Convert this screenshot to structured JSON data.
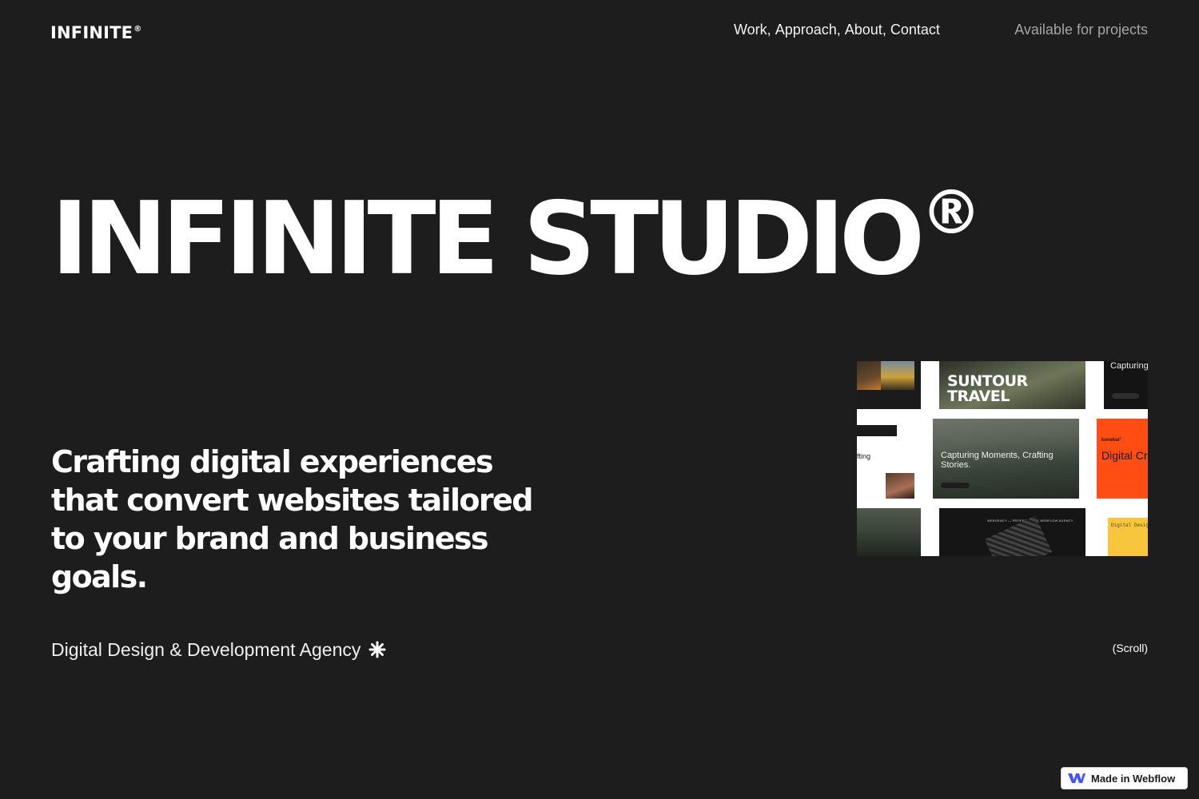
{
  "header": {
    "logo": "INFINITE",
    "logo_mark": "®",
    "nav": [
      {
        "label": "Work",
        "sep": ", "
      },
      {
        "label": "Approach",
        "sep": ", "
      },
      {
        "label": "About",
        "sep": ", "
      },
      {
        "label": "Contact",
        "sep": ""
      }
    ],
    "availability": "Available for projects"
  },
  "hero": {
    "title": "INFINITE STUDIO",
    "title_mark": "®",
    "tagline": "Crafting digital experiences that convert websites tailored to your brand and business goals.",
    "agency": "Digital Design & Development Agency",
    "agency_icon": "asterisk-icon",
    "scroll_hint": "(Scroll)"
  },
  "collage": {
    "suntour": "SUNTOUR TRAVEL",
    "capturing_short": "Capturing Crafting S",
    "capturing_full": "Capturing Moments, Crafting Stories.",
    "crafting": "fting",
    "konekta_brand": "konekai°",
    "digital_marketing": "Digital Cr Marketin",
    "webflow_agency": "WEBGENCY — PROFESSIONAL WEBFLOW AGENCY",
    "yellow_card": "Digital Desig San Francisco Research & St"
  },
  "badge": {
    "label": "Made in Webflow",
    "icon": "webflow-logo-icon",
    "color": "#4353ff"
  },
  "colors": {
    "background": "#1d1d1d",
    "text": "#ffffff",
    "muted": "#a5a5a5",
    "accent_orange": "#ff4d14",
    "accent_yellow": "#f8c63c"
  }
}
